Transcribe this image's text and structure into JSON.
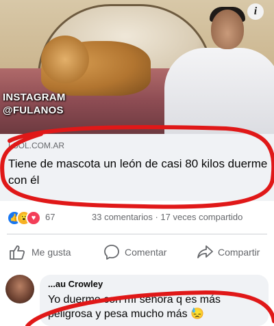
{
  "photo": {
    "watermark_line1": "INSTAGRAM",
    "watermark_line2": "@FULANOS",
    "info_glyph": "i"
  },
  "link_preview": {
    "source": "LSOL.COM.AR",
    "headline": "Tiene de mascota un león de casi 80 kilos duerme con él"
  },
  "reactions": {
    "count": "67",
    "stats": "33 comentarios · 17 veces compartido",
    "icons": [
      "like-icon",
      "wow-icon",
      "love-icon"
    ]
  },
  "actions": {
    "like": "Me gusta",
    "comment": "Comentar",
    "share": "Compartir"
  },
  "comment": {
    "author": "...au Crowley",
    "text": "Yo duermo con mí señora  q es más peligrosa y pesa mucho más 😓"
  },
  "colors": {
    "accent": "#1877f2",
    "annotation": "#e01818"
  }
}
